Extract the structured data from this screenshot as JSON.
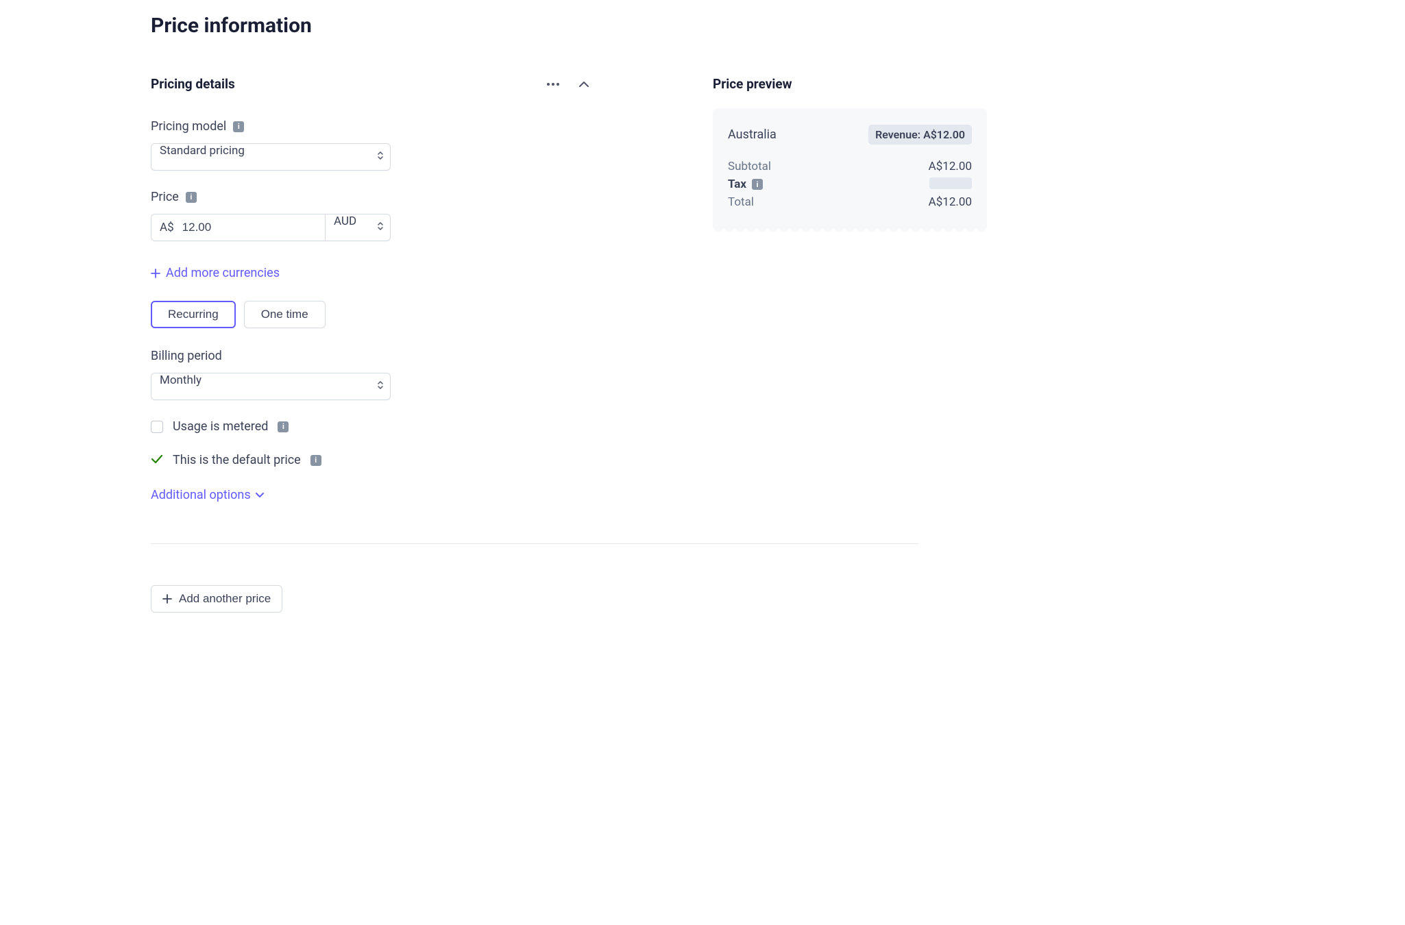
{
  "page": {
    "title": "Price information"
  },
  "pricing_details": {
    "section_title": "Pricing details",
    "model_label": "Pricing model",
    "model_value": "Standard pricing",
    "price_label": "Price",
    "price_prefix": "A$",
    "price_value": "12.00",
    "currency_value": "AUD",
    "add_currencies": "Add more currencies",
    "recurring_label": "Recurring",
    "onetime_label": "One time",
    "billing_period_label": "Billing period",
    "billing_period_value": "Monthly",
    "metered_label": "Usage is metered",
    "default_price_label": "This is the default price",
    "additional_options": "Additional options"
  },
  "add_another": "Add another price",
  "preview": {
    "title": "Price preview",
    "country": "Australia",
    "revenue_badge": "Revenue: A$12.00",
    "subtotal_label": "Subtotal",
    "subtotal_value": "A$12.00",
    "tax_label": "Tax",
    "total_label": "Total",
    "total_value": "A$12.00"
  }
}
